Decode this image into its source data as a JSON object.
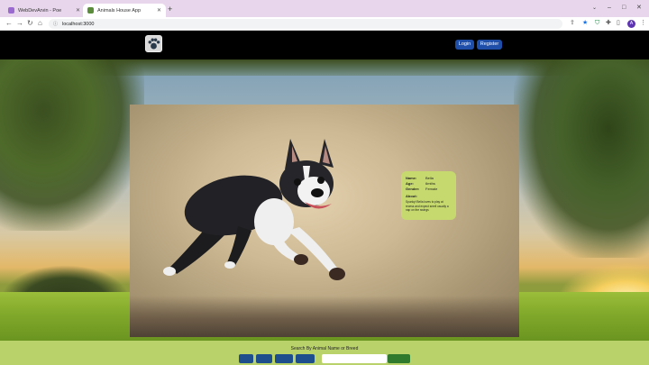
{
  "browser": {
    "tabs": [
      {
        "title": "WebDevArvin - Poe",
        "active": false
      },
      {
        "title": "Animals House App",
        "active": true
      }
    ],
    "new_tab_symbol": "+",
    "url": "localhost:3000",
    "profile_initial": "A"
  },
  "navbar": {
    "logo_icon": "paw-icon",
    "login_label": "Login",
    "register_label": "Register"
  },
  "animal_card": {
    "name_label": "Name:",
    "name_value": "Bella",
    "age_label": "Age:",
    "age_value": "6mths",
    "gender_label": "Gender:",
    "gender_value": "Female",
    "about_label": "About:",
    "about_text": "Spunky! Bella loves to play at recess and expect smell usually a nap on the swings"
  },
  "search": {
    "label": "Search By Animal Name or Breed",
    "placeholder": ""
  },
  "colors": {
    "nav_button": "#1f4ea8",
    "card_bg": "#c5d96e",
    "search_band": "#b9d36a"
  }
}
